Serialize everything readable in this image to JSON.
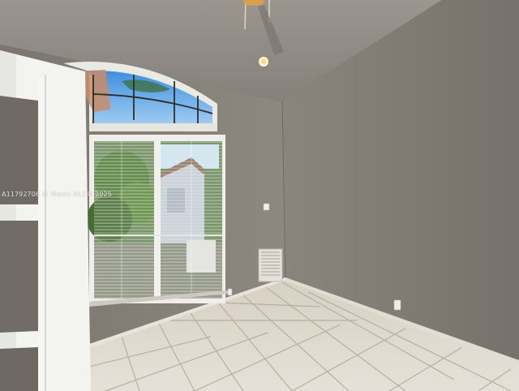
{
  "photo": {
    "subject": "empty room",
    "watermark": "A11792706 © Miami MLS® 2025"
  },
  "colors": {
    "wall_left": "#8c877e",
    "wall_right": "#7e796f",
    "ceiling": "#8e8a84",
    "floor_tile": "#d9d3c8",
    "grout": "#b9b1a3",
    "door_frame": "#f2f2ef"
  },
  "icons": [
    "ceiling-fan-icon",
    "ceiling-light-icon",
    "thermostat-icon",
    "air-vent-icon",
    "outlet-icon"
  ]
}
